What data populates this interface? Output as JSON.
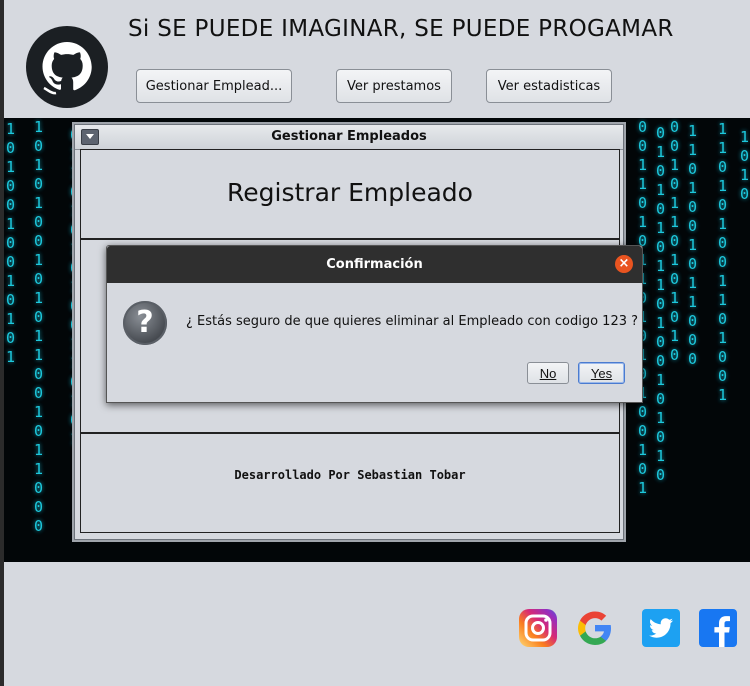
{
  "header": {
    "slogan": "Si SE PUEDE IMAGINAR, SE PUEDE PROGAMAR",
    "buttons": [
      "Gestionar Emplead...",
      "Ver prestamos",
      "Ver estadisticas"
    ]
  },
  "internal_window": {
    "title": "Gestionar Empleados",
    "heading": "Registrar Empleado",
    "credit": "Desarrollado Por Sebastian Tobar"
  },
  "dialog": {
    "title": "Confirmación",
    "message": "¿ Estás seguro de que quieres eliminar al Empleado con codigo 123  ?",
    "no_label": "No",
    "yes_label": "Yes",
    "close_glyph": "×",
    "question_glyph": "?"
  },
  "social": [
    "instagram-icon",
    "google-icon",
    "twitter-icon",
    "facebook-icon"
  ],
  "colors": {
    "matrix_digit": "#1fd3e8",
    "dialog_title_bg": "#2f2f2f",
    "close_button": "#e95420"
  }
}
